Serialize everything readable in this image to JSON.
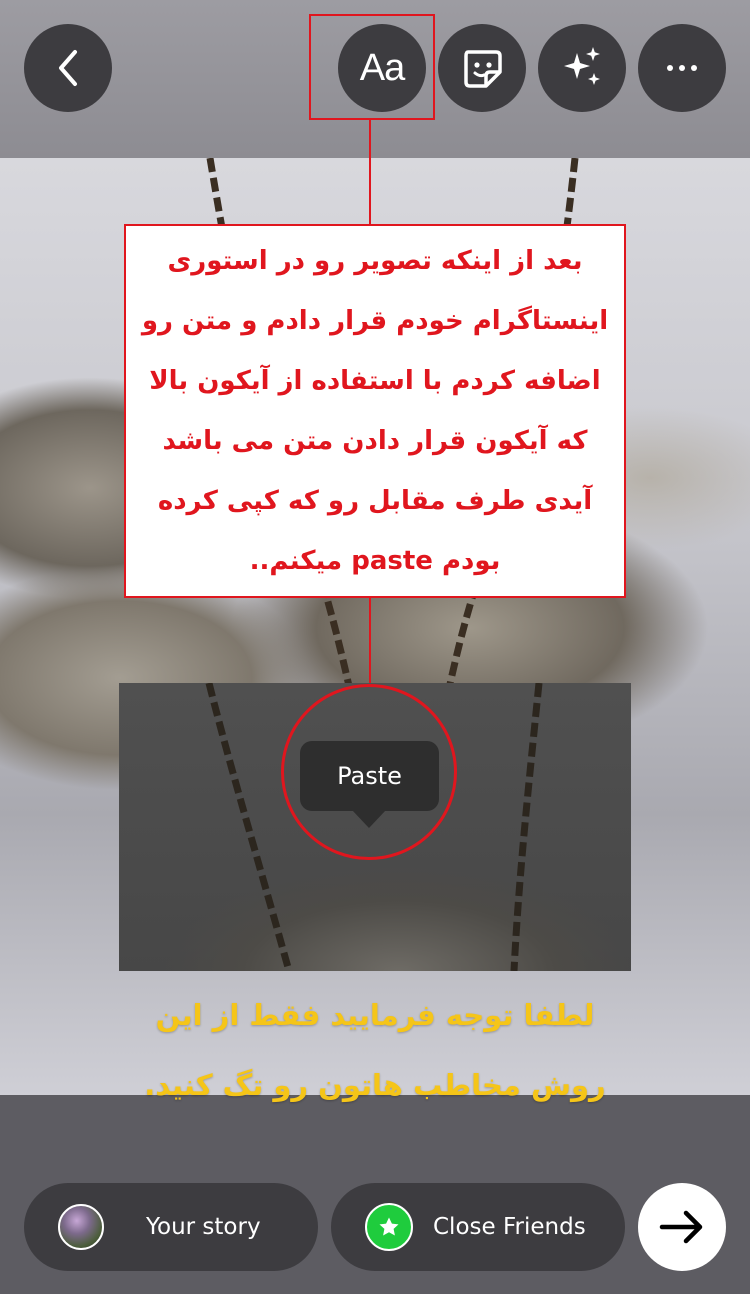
{
  "toolbar": {
    "text_tool_label": "Aa",
    "more_label": "···"
  },
  "annotation": {
    "note_lines": [
      "بعد از اینکه تصویر رو در استوری",
      "اینستاگرام خودم قرار دادم و متن رو",
      "اضافه کردم با استفاده از آیکون بالا",
      "که آیکون قرار دادن متن می باشد",
      "آیدی طرف مقابل رو که کپی کرده",
      "بودم paste میکنم.."
    ],
    "highlight_color": "#e0161e"
  },
  "context_menu": {
    "paste_label": "Paste"
  },
  "caption": {
    "lines": [
      "لطفا توجه فرمایید فقط از این",
      "روش مخاطب هاتون رو تگ کنید."
    ],
    "color": "#f5c518"
  },
  "share": {
    "your_story_label": "Your story",
    "close_friends_label": "Close Friends",
    "close_friends_color": "#1fcc3d"
  },
  "icons": {
    "back": "chevron-left-icon",
    "sticker": "sticker-icon",
    "effects": "sparkles-icon",
    "more": "more-horizontal-icon",
    "send": "arrow-right-icon"
  }
}
